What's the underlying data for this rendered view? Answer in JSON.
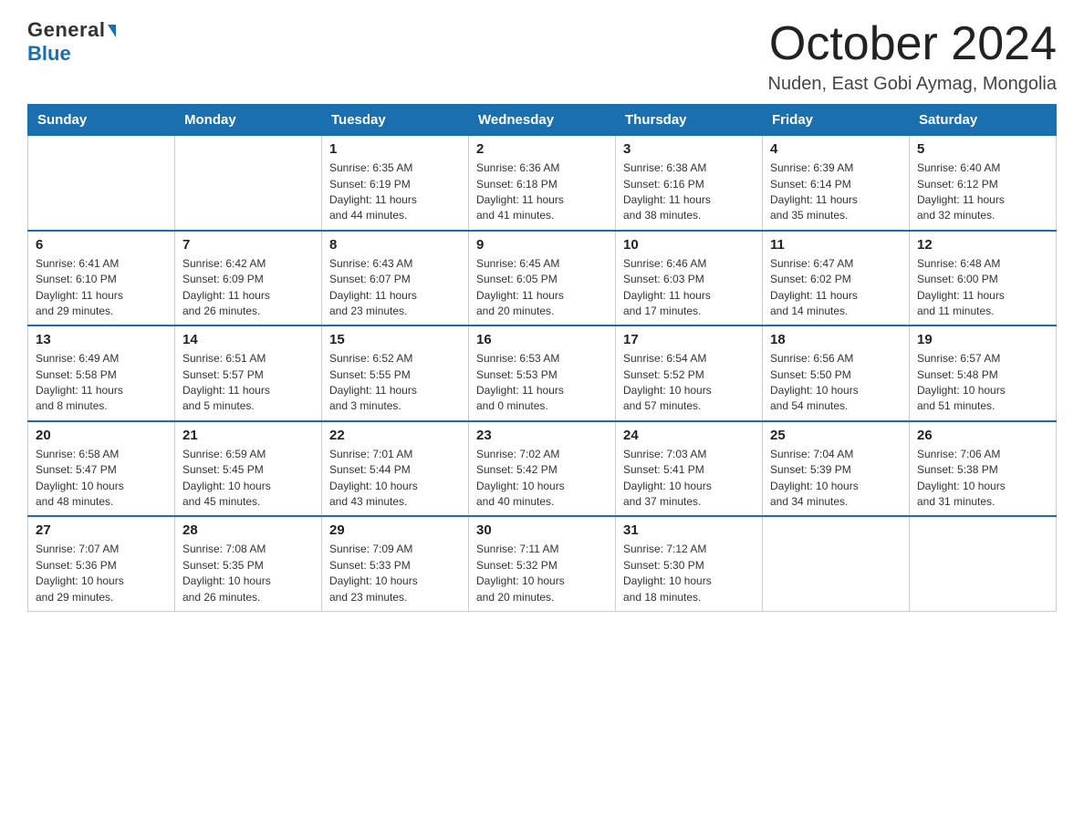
{
  "logo": {
    "general": "General",
    "blue": "Blue"
  },
  "header": {
    "month": "October 2024",
    "location": "Nuden, East Gobi Aymag, Mongolia"
  },
  "weekdays": [
    "Sunday",
    "Monday",
    "Tuesday",
    "Wednesday",
    "Thursday",
    "Friday",
    "Saturday"
  ],
  "weeks": [
    [
      {
        "day": "",
        "info": ""
      },
      {
        "day": "",
        "info": ""
      },
      {
        "day": "1",
        "info": "Sunrise: 6:35 AM\nSunset: 6:19 PM\nDaylight: 11 hours\nand 44 minutes."
      },
      {
        "day": "2",
        "info": "Sunrise: 6:36 AM\nSunset: 6:18 PM\nDaylight: 11 hours\nand 41 minutes."
      },
      {
        "day": "3",
        "info": "Sunrise: 6:38 AM\nSunset: 6:16 PM\nDaylight: 11 hours\nand 38 minutes."
      },
      {
        "day": "4",
        "info": "Sunrise: 6:39 AM\nSunset: 6:14 PM\nDaylight: 11 hours\nand 35 minutes."
      },
      {
        "day": "5",
        "info": "Sunrise: 6:40 AM\nSunset: 6:12 PM\nDaylight: 11 hours\nand 32 minutes."
      }
    ],
    [
      {
        "day": "6",
        "info": "Sunrise: 6:41 AM\nSunset: 6:10 PM\nDaylight: 11 hours\nand 29 minutes."
      },
      {
        "day": "7",
        "info": "Sunrise: 6:42 AM\nSunset: 6:09 PM\nDaylight: 11 hours\nand 26 minutes."
      },
      {
        "day": "8",
        "info": "Sunrise: 6:43 AM\nSunset: 6:07 PM\nDaylight: 11 hours\nand 23 minutes."
      },
      {
        "day": "9",
        "info": "Sunrise: 6:45 AM\nSunset: 6:05 PM\nDaylight: 11 hours\nand 20 minutes."
      },
      {
        "day": "10",
        "info": "Sunrise: 6:46 AM\nSunset: 6:03 PM\nDaylight: 11 hours\nand 17 minutes."
      },
      {
        "day": "11",
        "info": "Sunrise: 6:47 AM\nSunset: 6:02 PM\nDaylight: 11 hours\nand 14 minutes."
      },
      {
        "day": "12",
        "info": "Sunrise: 6:48 AM\nSunset: 6:00 PM\nDaylight: 11 hours\nand 11 minutes."
      }
    ],
    [
      {
        "day": "13",
        "info": "Sunrise: 6:49 AM\nSunset: 5:58 PM\nDaylight: 11 hours\nand 8 minutes."
      },
      {
        "day": "14",
        "info": "Sunrise: 6:51 AM\nSunset: 5:57 PM\nDaylight: 11 hours\nand 5 minutes."
      },
      {
        "day": "15",
        "info": "Sunrise: 6:52 AM\nSunset: 5:55 PM\nDaylight: 11 hours\nand 3 minutes."
      },
      {
        "day": "16",
        "info": "Sunrise: 6:53 AM\nSunset: 5:53 PM\nDaylight: 11 hours\nand 0 minutes."
      },
      {
        "day": "17",
        "info": "Sunrise: 6:54 AM\nSunset: 5:52 PM\nDaylight: 10 hours\nand 57 minutes."
      },
      {
        "day": "18",
        "info": "Sunrise: 6:56 AM\nSunset: 5:50 PM\nDaylight: 10 hours\nand 54 minutes."
      },
      {
        "day": "19",
        "info": "Sunrise: 6:57 AM\nSunset: 5:48 PM\nDaylight: 10 hours\nand 51 minutes."
      }
    ],
    [
      {
        "day": "20",
        "info": "Sunrise: 6:58 AM\nSunset: 5:47 PM\nDaylight: 10 hours\nand 48 minutes."
      },
      {
        "day": "21",
        "info": "Sunrise: 6:59 AM\nSunset: 5:45 PM\nDaylight: 10 hours\nand 45 minutes."
      },
      {
        "day": "22",
        "info": "Sunrise: 7:01 AM\nSunset: 5:44 PM\nDaylight: 10 hours\nand 43 minutes."
      },
      {
        "day": "23",
        "info": "Sunrise: 7:02 AM\nSunset: 5:42 PM\nDaylight: 10 hours\nand 40 minutes."
      },
      {
        "day": "24",
        "info": "Sunrise: 7:03 AM\nSunset: 5:41 PM\nDaylight: 10 hours\nand 37 minutes."
      },
      {
        "day": "25",
        "info": "Sunrise: 7:04 AM\nSunset: 5:39 PM\nDaylight: 10 hours\nand 34 minutes."
      },
      {
        "day": "26",
        "info": "Sunrise: 7:06 AM\nSunset: 5:38 PM\nDaylight: 10 hours\nand 31 minutes."
      }
    ],
    [
      {
        "day": "27",
        "info": "Sunrise: 7:07 AM\nSunset: 5:36 PM\nDaylight: 10 hours\nand 29 minutes."
      },
      {
        "day": "28",
        "info": "Sunrise: 7:08 AM\nSunset: 5:35 PM\nDaylight: 10 hours\nand 26 minutes."
      },
      {
        "day": "29",
        "info": "Sunrise: 7:09 AM\nSunset: 5:33 PM\nDaylight: 10 hours\nand 23 minutes."
      },
      {
        "day": "30",
        "info": "Sunrise: 7:11 AM\nSunset: 5:32 PM\nDaylight: 10 hours\nand 20 minutes."
      },
      {
        "day": "31",
        "info": "Sunrise: 7:12 AM\nSunset: 5:30 PM\nDaylight: 10 hours\nand 18 minutes."
      },
      {
        "day": "",
        "info": ""
      },
      {
        "day": "",
        "info": ""
      }
    ]
  ]
}
